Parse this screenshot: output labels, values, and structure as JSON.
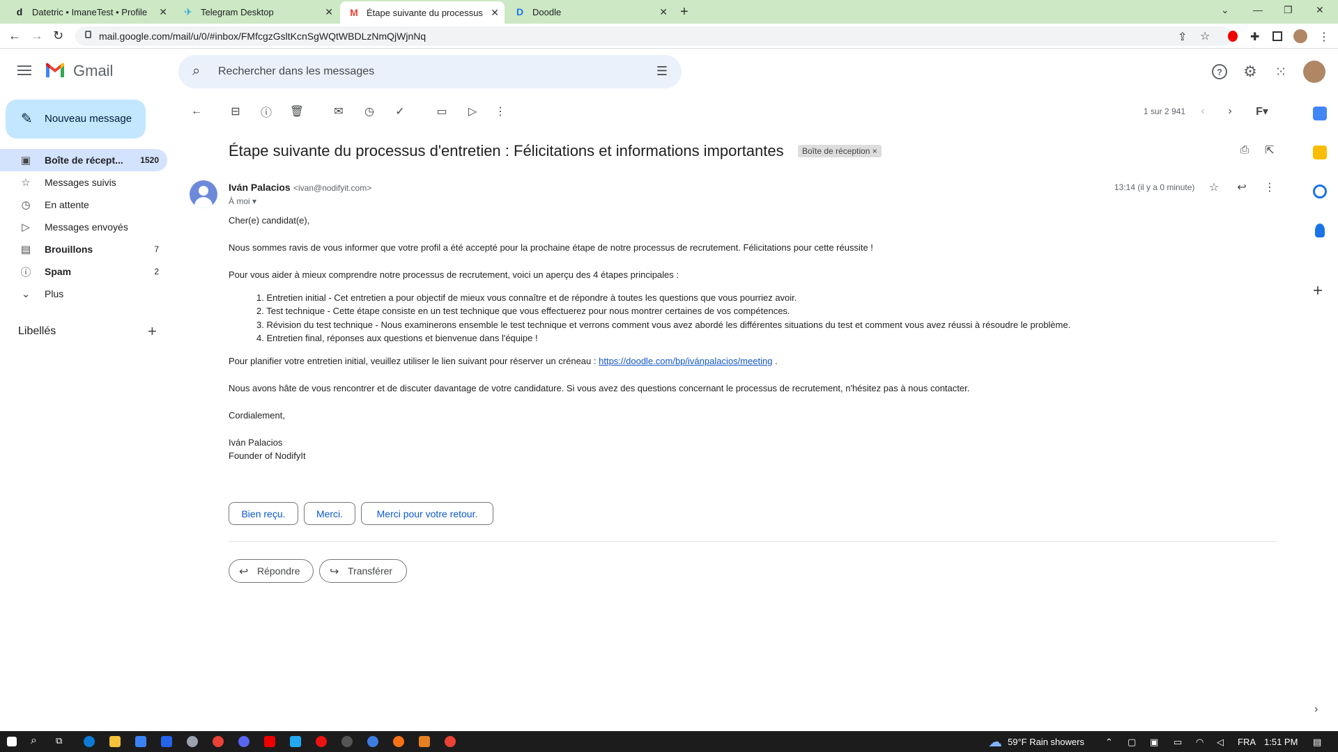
{
  "browser": {
    "tabs": [
      {
        "title": "Datetric • ImaneTest • Profile",
        "favicon": "d",
        "close": "✕"
      },
      {
        "title": "Telegram Desktop",
        "favicon": "✈",
        "close": "✕"
      },
      {
        "title": "Étape suivante du processus d'en",
        "favicon": "M",
        "close": "✕"
      },
      {
        "title": "Doodle",
        "favicon": "D",
        "close": "✕"
      }
    ],
    "new_tab": "+",
    "url": "mail.google.com/mail/u/0/#inbox/FMfcgzGsltKcnSgWQtWBDLzNmQjWjnNq"
  },
  "gmail": {
    "logo_text": "Gmail",
    "search_placeholder": "Rechercher dans les messages",
    "compose_label": "Nouveau message",
    "nav": [
      {
        "label": "Boîte de récept...",
        "count": "1520",
        "icon": "inbox-icon"
      },
      {
        "label": "Messages suivis",
        "count": "",
        "icon": "star-icon"
      },
      {
        "label": "En attente",
        "count": "",
        "icon": "clock-icon"
      },
      {
        "label": "Messages envoyés",
        "count": "",
        "icon": "send-icon"
      },
      {
        "label": "Brouillons",
        "count": "7",
        "icon": "draft-icon"
      },
      {
        "label": "Spam",
        "count": "2",
        "icon": "spam-icon"
      },
      {
        "label": "Plus",
        "count": "",
        "icon": "chevron-down-icon"
      }
    ],
    "labels_heading": "Libellés",
    "pager": "1 sur 2 941",
    "accent": "#0b57d0"
  },
  "email": {
    "subject": "Étape suivante du processus d'entretien : Félicitations et informations importantes",
    "label_chip": "Boîte de réception",
    "sender_name": "Iván Palacios",
    "sender_email": "<ivan@nodifyit.com>",
    "to": "À moi",
    "time": "13:14 (il y a 0 minute)",
    "greeting": "Cher(e) candidat(e),",
    "p1": "Nous sommes ravis de vous informer que votre profil a été accepté pour la prochaine étape de notre processus de recrutement. Félicitations pour cette réussite !",
    "p2": "Pour vous aider à mieux comprendre notre processus de recrutement, voici un aperçu des 4 étapes principales :",
    "steps": [
      "1. Entretien initial - Cet entretien a pour objectif de mieux vous connaître et de répondre à toutes les questions que vous pourriez avoir.",
      "2. Test technique - Cette étape consiste en un test technique que vous effectuerez pour nous montrer certaines de vos compétences.",
      "3. Révision du test technique - Nous examinerons ensemble le test technique et verrons comment vous avez abordé les différentes situations du test et comment vous avez réussi à résoudre le problème.",
      "4. Entretien final, réponses aux questions et bienvenue dans l'équipe !"
    ],
    "p3_prefix": "Pour planifier votre entretien initial, veuillez utiliser le lien suivant pour réserver un créneau : ",
    "p3_link": "https://doodle.com/bp/ivánpalacios/meeting",
    "p3_suffix": " .",
    "p4": "Nous avons hâte de vous rencontrer et de discuter davantage de votre candidature. Si vous avez des questions concernant le processus de recrutement, n'hésitez pas à nous contacter.",
    "closing": "Cordialement,",
    "sig_name": "Iván Palacios",
    "sig_title": "Founder of NodifyIt",
    "smart_replies": [
      "Bien reçu.",
      "Merci.",
      "Merci pour votre retour."
    ],
    "reply_label": "Répondre",
    "forward_label": "Transférer"
  },
  "taskbar": {
    "weather": "59°F  Rain showers",
    "lang": "FRA",
    "clock": "1:51 PM"
  }
}
